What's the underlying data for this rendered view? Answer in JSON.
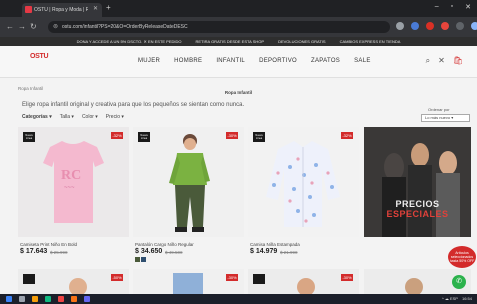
{
  "browser": {
    "tab_title": "OSTU | Ropa y Moda | Ropa In",
    "tab_close": "✕",
    "new_tab": "+",
    "url": "ostu.com/infantil?PS=20&O=OrderByReleaseDateDESC",
    "window_controls": [
      "–",
      "▫",
      "✕"
    ]
  },
  "promo_bar": {
    "items": [
      "DONA Y ACCEDE A UN 5% DSCTO. ✕ EN ESTE PEDIDO",
      "RETIRA GRATIS DESDE ESTA SHOP",
      "DEVOLUCIONES GRATIS",
      "CAMBIOS EXPRESS EN TIENDA"
    ]
  },
  "header": {
    "logo": "OSTU",
    "nav": [
      "MUJER",
      "HOMBRE",
      "INFANTIL",
      "DEPORTIVO",
      "ZAPATOS",
      "SALE"
    ],
    "icons": {
      "search": "⌕",
      "close": "✕",
      "cart": "🛍"
    }
  },
  "breadcrumb": "Ropa Infantil",
  "page_heading": "Ropa Infantil",
  "description": "Elige ropa infantil original y creativa para que los pequeños se sientan como nunca.",
  "filters": [
    "Categorías ▾",
    "Talla ▾",
    "Color ▾",
    "Precio ▾"
  ],
  "sort": {
    "label": "Ordenar por",
    "value": "Lo más nuevo ▾"
  },
  "products": [
    {
      "name": "Camiseta Print Niño En Bold",
      "price": "$ 17.643",
      "old_price": "$ 25.990",
      "badge_new": "Nueva Línea",
      "discount": "-32%"
    },
    {
      "name": "Pantalón Cargo Niño Regular",
      "price": "$ 34.650",
      "old_price": "$ 49.500",
      "badge_new": "Nueva Línea",
      "discount": "-30%"
    },
    {
      "name": "Camisa Niña Estampada",
      "price": "$ 14.979",
      "old_price": "$ 21.990",
      "badge_new": "Nueva Línea",
      "discount": "-32%"
    }
  ],
  "promo_banner": {
    "line1": "PRECIOS",
    "line2": "ESPECIALES"
  },
  "sale_bubble": "Artículos seleccionados hasta 50% OFF",
  "row2_discounts": [
    "-50%",
    "-30%",
    "-30%"
  ],
  "taskbar": {
    "time": "16:54",
    "status": "^ ☁ ESP"
  },
  "colors": {
    "accent": "#d32b2b",
    "chrome": "#202124",
    "whatsapp": "#2bb24c"
  }
}
